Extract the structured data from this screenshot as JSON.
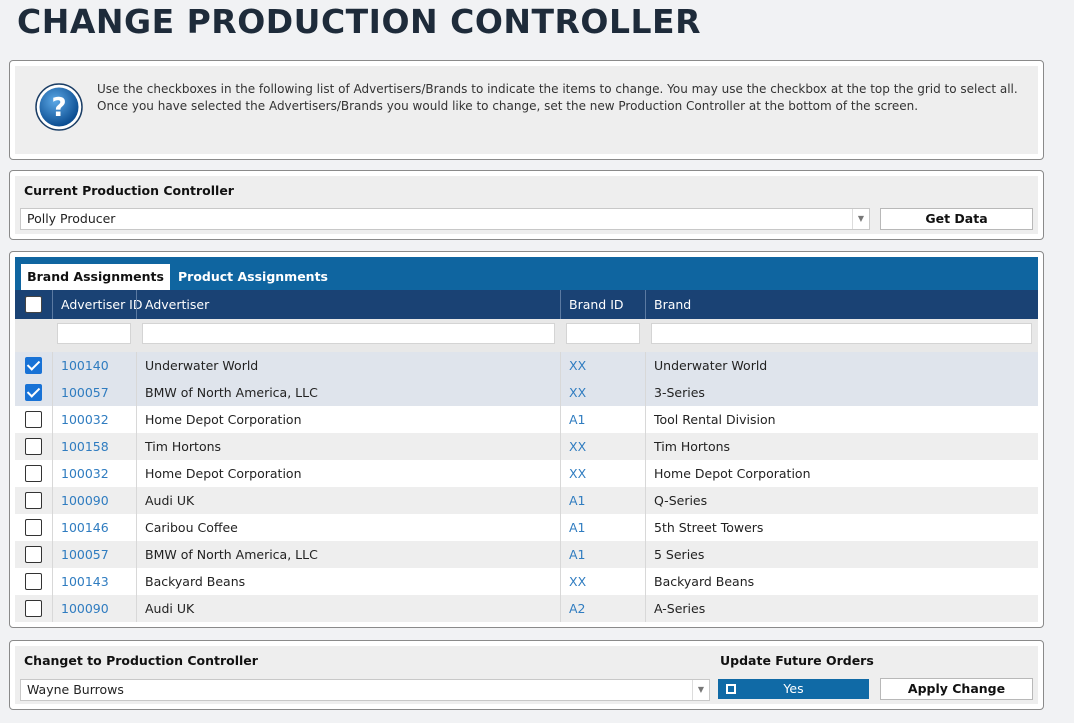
{
  "page": {
    "title": "CHANGE PRODUCTION CONTROLLER",
    "info_text": "Use the checkboxes in the following list of Advertisers/Brands to indicate the items to change. You may use the checkbox at the top the grid to select all. Once you have selected the Advertisers/Brands you would like to change, set the new Production Controller at the bottom of the screen.",
    "help_icon": "question-icon"
  },
  "current": {
    "label": "Current Production Controller",
    "selected": "Polly Producer",
    "get_data_label": "Get Data"
  },
  "tabs": [
    {
      "label": "Brand Assignments",
      "active": true
    },
    {
      "label": "Product Assignments",
      "active": false
    }
  ],
  "grid": {
    "columns": [
      "Advertiser ID",
      "Advertiser",
      "Brand ID",
      "Brand"
    ],
    "rows": [
      {
        "checked": true,
        "advertiser_id": "100140",
        "advertiser": "Underwater World",
        "brand_id": "XX",
        "brand": "Underwater World"
      },
      {
        "checked": true,
        "advertiser_id": "100057",
        "advertiser": "BMW of North America, LLC",
        "brand_id": "XX",
        "brand": "3-Series"
      },
      {
        "checked": false,
        "advertiser_id": "100032",
        "advertiser": "Home Depot Corporation",
        "brand_id": "A1",
        "brand": "Tool Rental Division"
      },
      {
        "checked": false,
        "advertiser_id": "100158",
        "advertiser": "Tim Hortons",
        "brand_id": "XX",
        "brand": "Tim Hortons"
      },
      {
        "checked": false,
        "advertiser_id": "100032",
        "advertiser": "Home Depot Corporation",
        "brand_id": "XX",
        "brand": "Home Depot Corporation"
      },
      {
        "checked": false,
        "advertiser_id": "100090",
        "advertiser": "Audi UK",
        "brand_id": "A1",
        "brand": "Q-Series"
      },
      {
        "checked": false,
        "advertiser_id": "100146",
        "advertiser": "Caribou Coffee",
        "brand_id": "A1",
        "brand": "5th Street Towers"
      },
      {
        "checked": false,
        "advertiser_id": "100057",
        "advertiser": "BMW of North America, LLC",
        "brand_id": "A1",
        "brand": "5 Series"
      },
      {
        "checked": false,
        "advertiser_id": "100143",
        "advertiser": "Backyard Beans",
        "brand_id": "XX",
        "brand": "Backyard Beans"
      },
      {
        "checked": false,
        "advertiser_id": "100090",
        "advertiser": "Audi UK",
        "brand_id": "A2",
        "brand": "A-Series"
      }
    ]
  },
  "change": {
    "label": "Changet to Production Controller",
    "selected": "Wayne Burrows",
    "update_label": "Update Future Orders",
    "update_value": "Yes",
    "apply_label": "Apply Change"
  },
  "colors": {
    "tabbar": "#0f65a0",
    "grid_header": "#1a4274",
    "link": "#2f7cc0",
    "checkbox_checked": "#1872d6"
  }
}
